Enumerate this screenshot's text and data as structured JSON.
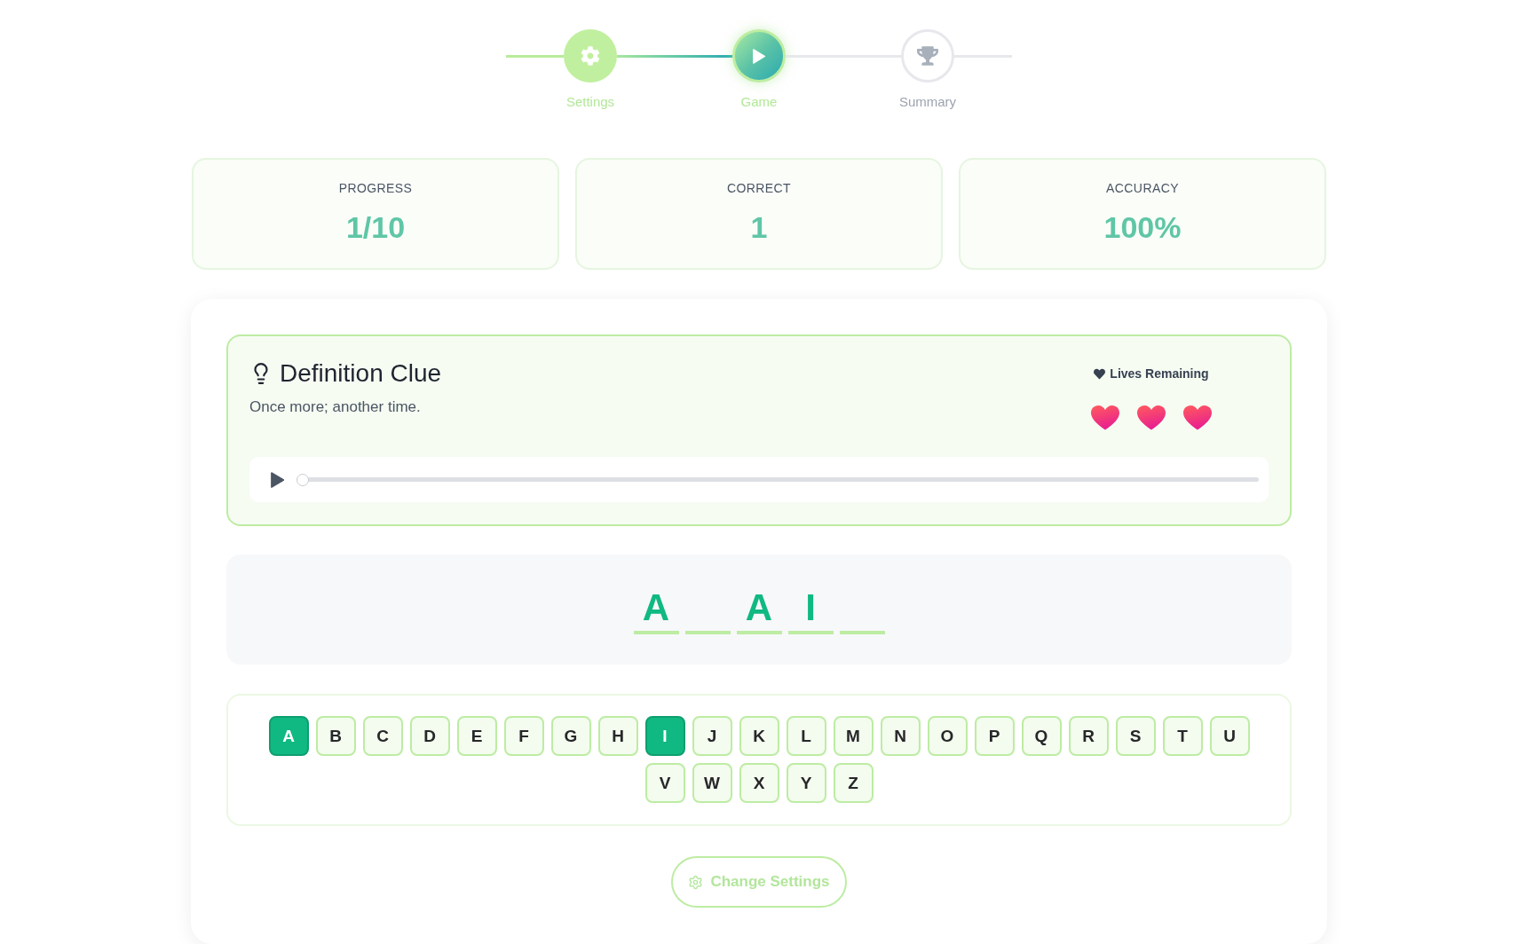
{
  "stepper": {
    "steps": [
      {
        "label": "Settings",
        "completed": true,
        "selected": false
      },
      {
        "label": "Game",
        "completed": false,
        "selected": true
      },
      {
        "label": "Summary",
        "completed": false,
        "selected": false
      }
    ]
  },
  "stats": [
    {
      "label": "PROGRESS",
      "value": "1/10"
    },
    {
      "label": "CORRECT",
      "value": "1"
    },
    {
      "label": "ACCURACY",
      "value": "100%"
    }
  ],
  "clue": {
    "title": "Definition Clue",
    "text": "Once more; another time.",
    "audio": {
      "level": 0
    }
  },
  "lives": {
    "label": "Lives Remaining",
    "hearts": [
      {
        "remaining": true
      },
      {
        "remaining": true
      },
      {
        "remaining": true
      }
    ]
  },
  "word": {
    "slots": [
      {
        "kind": "letter",
        "letter": "A"
      },
      {
        "kind": "blank"
      },
      {
        "kind": "letter",
        "letter": "A"
      },
      {
        "kind": "letter",
        "letter": "I"
      },
      {
        "kind": "blank"
      }
    ]
  },
  "keyboard": {
    "keys": [
      {
        "letter": "A",
        "guessed": true
      },
      {
        "letter": "B",
        "guessed": false
      },
      {
        "letter": "C",
        "guessed": false
      },
      {
        "letter": "D",
        "guessed": false
      },
      {
        "letter": "E",
        "guessed": false
      },
      {
        "letter": "F",
        "guessed": false
      },
      {
        "letter": "G",
        "guessed": false
      },
      {
        "letter": "H",
        "guessed": false
      },
      {
        "letter": "I",
        "guessed": true
      },
      {
        "letter": "J",
        "guessed": false
      },
      {
        "letter": "K",
        "guessed": false
      },
      {
        "letter": "L",
        "guessed": false
      },
      {
        "letter": "M",
        "guessed": false
      },
      {
        "letter": "N",
        "guessed": false
      },
      {
        "letter": "O",
        "guessed": false
      },
      {
        "letter": "P",
        "guessed": false
      },
      {
        "letter": "Q",
        "guessed": false
      },
      {
        "letter": "R",
        "guessed": false
      },
      {
        "letter": "S",
        "guessed": false
      },
      {
        "letter": "T",
        "guessed": false
      },
      {
        "letter": "U",
        "guessed": false
      },
      {
        "letter": "V",
        "guessed": false
      },
      {
        "letter": "W",
        "guessed": false
      },
      {
        "letter": "X",
        "guessed": false
      },
      {
        "letter": "Y",
        "guessed": false
      },
      {
        "letter": "Z",
        "guessed": false
      }
    ]
  },
  "change_settings_button": {
    "label": "Change Settings"
  }
}
